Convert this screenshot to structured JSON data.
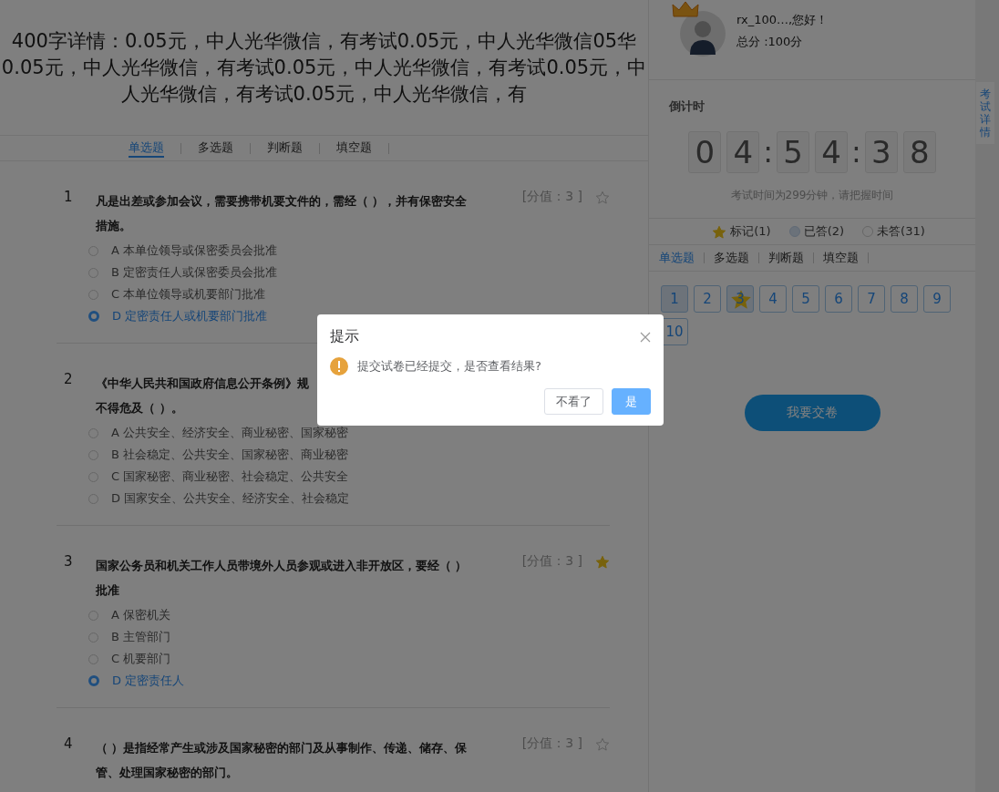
{
  "header": {
    "title_lines": [
      "400字详情：0.05元，中人光华微信，有考试0.05元，中人光华微信05华",
      "0.05元，中人光华微信，有考试0.05元，中人光华微信，有考试0.05元，中",
      "人光华微信，有考试0.05元，中人光华微信，有"
    ]
  },
  "type_tabs": [
    {
      "label": "单选题",
      "selected": true
    },
    {
      "label": "多选题",
      "selected": false
    },
    {
      "label": "判断题",
      "selected": false
    },
    {
      "label": "填空题",
      "selected": false
    }
  ],
  "questions": [
    {
      "number": "1",
      "lines": [
        "凡是出差或参加会议，需要携带机要文件的，需经（ ），并有保密安全",
        "措施。"
      ],
      "score": "[分值：3 ]",
      "starred": false,
      "options": [
        {
          "text": "A 本单位领导或保密委员会批准",
          "selected": false
        },
        {
          "text": "B 定密责任人或保密委员会批准",
          "selected": false
        },
        {
          "text": "C 本单位领导或机要部门批准",
          "selected": false
        },
        {
          "text": "D 定密责任人或机要部门批准",
          "selected": true
        }
      ]
    },
    {
      "number": "2",
      "lines": [
        "《中华人民共和国政府信息公开条例》规",
        "不得危及（ ）。"
      ],
      "options": [
        {
          "text": "A 公共安全、经济安全、商业秘密、国家秘密",
          "selected": false
        },
        {
          "text": "B 社会稳定、公共安全、国家秘密、商业秘密",
          "selected": false
        },
        {
          "text": "C 国家秘密、商业秘密、社会稳定、公共安全",
          "selected": false
        },
        {
          "text": "D 国家安全、公共安全、经济安全、社会稳定",
          "selected": false
        }
      ]
    },
    {
      "number": "3",
      "lines": [
        "国家公务员和机关工作人员带境外人员参观或进入非开放区，要经（ ）",
        "批准"
      ],
      "score": "[分值：3 ]",
      "starred": true,
      "options": [
        {
          "text": "A 保密机关",
          "selected": false
        },
        {
          "text": "B 主管部门",
          "selected": false
        },
        {
          "text": "C 机要部门",
          "selected": false
        },
        {
          "text": "D 定密责任人",
          "selected": true
        }
      ]
    },
    {
      "number": "4",
      "lines": [
        "（ ）是指经常产生或涉及国家秘密的部门及从事制作、传递、储存、保",
        "管、处理国家秘密的部门。"
      ],
      "score": "[分值：3 ]",
      "starred": false
    }
  ],
  "user": {
    "greeting": "rx_100…,您好！",
    "score": "总分 :100分"
  },
  "countdown": {
    "label": "倒计时",
    "digits": [
      {
        "kind": "digit",
        "text": "0"
      },
      {
        "kind": "digit",
        "text": "4"
      },
      {
        "kind": "colon",
        "text": ":"
      },
      {
        "kind": "digit",
        "text": "5"
      },
      {
        "kind": "digit",
        "text": "4"
      },
      {
        "kind": "colon",
        "text": ":"
      },
      {
        "kind": "digit",
        "text": "3"
      },
      {
        "kind": "digit",
        "text": "8"
      }
    ],
    "note": "考试时间为299分钟，请把握时间"
  },
  "legend": [
    {
      "kind": "marked",
      "label": "标记(1)"
    },
    {
      "kind": "answered",
      "label": "已答(2)"
    },
    {
      "kind": "unanswered",
      "label": "未答(31)"
    }
  ],
  "panel_tabs": [
    {
      "label": "单选题",
      "selected": true
    },
    {
      "label": "多选题",
      "selected": false
    },
    {
      "label": "判断题",
      "selected": false
    },
    {
      "label": "填空题",
      "selected": false
    }
  ],
  "answer_sheet": [
    {
      "number": "1",
      "answered": true,
      "marked": false
    },
    {
      "number": "2",
      "answered": false,
      "marked": false
    },
    {
      "number": "3",
      "answered": true,
      "marked": true
    },
    {
      "number": "4",
      "answered": false,
      "marked": false
    },
    {
      "number": "5",
      "answered": false,
      "marked": false
    },
    {
      "number": "6",
      "answered": false,
      "marked": false
    },
    {
      "number": "7",
      "answered": false,
      "marked": false
    },
    {
      "number": "8",
      "answered": false,
      "marked": false
    },
    {
      "number": "9",
      "answered": false,
      "marked": false
    },
    {
      "number": "10",
      "answered": false,
      "marked": false
    }
  ],
  "submit_button": "我要交卷",
  "side_tab": "考试详情",
  "dialog": {
    "title": "提示",
    "message": "提交试卷已经提交，是否查看结果?",
    "buttons": [
      {
        "kind": "secondary",
        "label": "不看了"
      },
      {
        "kind": "primary",
        "label": "是"
      }
    ]
  }
}
